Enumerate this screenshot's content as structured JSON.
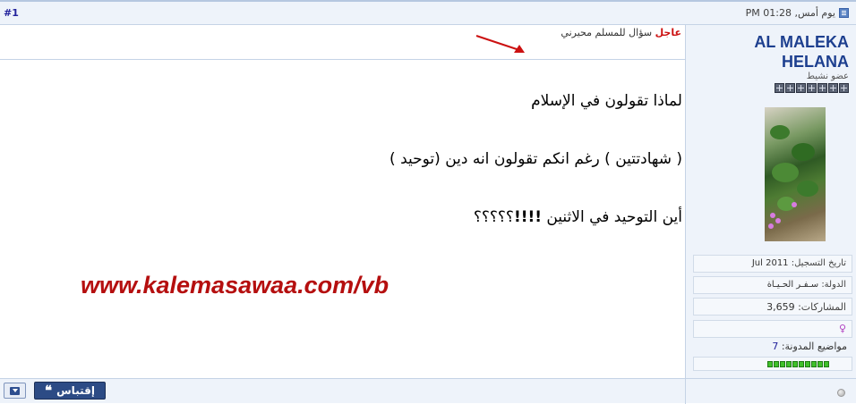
{
  "header": {
    "post_number": "#1",
    "date": "يوم أمس, 01:28 PM"
  },
  "post": {
    "urgent_label": "عاجل",
    "title": "سؤال للمسلم محيرني",
    "lines": [
      {
        "before": "لماذا تقولون في الإسلام",
        "bold": "",
        "after": ""
      },
      {
        "before": "( شهادتتين ) رغم انكم تقولون انه دين (توحيد )",
        "bold": "",
        "after": ""
      },
      {
        "before": "أين التوحيد في الاثنين ",
        "bold": "!!!!",
        "after": "؟؟؟؟؟"
      }
    ],
    "watermark": "www.kalemasawaa.com/vb"
  },
  "user": {
    "name": "AL MALEKA HELANA",
    "title": "عضو نشيط",
    "rank_icon_count": 7,
    "join_label": "تاريخ التسجيل:",
    "join_value": "Jul 2011",
    "country_label": "الدولة:",
    "country_value": "سـفـر الحـيـاة",
    "posts_label": "المشاركات:",
    "posts_value": "3,659",
    "gender_symbol": "♀",
    "blog_label": "مواضيع المدونة:",
    "blog_count": "7",
    "reputation_level": 10
  },
  "footer": {
    "quote_label": "إقتباس",
    "quote_icon": "❝"
  },
  "colors": {
    "header_bg": "#eef3fa",
    "username": "#1d3f8f",
    "urgent": "#cc1111",
    "watermark": "#b50f0f",
    "quote_button": "#2c4b85",
    "reputation": "#3fc02a"
  }
}
